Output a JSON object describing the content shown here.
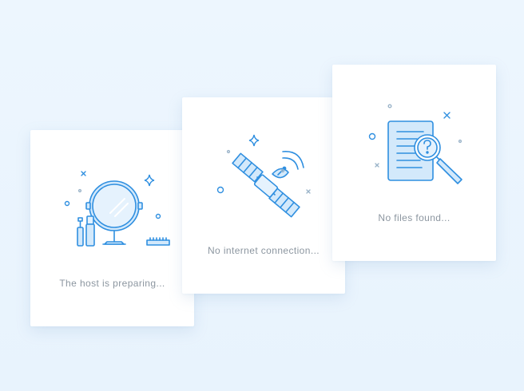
{
  "cards": [
    {
      "message": "The host is preparing...",
      "icon": "vanity-mirror-icon"
    },
    {
      "message": "No internet connection...",
      "icon": "satellite-icon"
    },
    {
      "message": "No files found...",
      "icon": "document-search-icon"
    }
  ],
  "colors": {
    "background": "#eaf4fd",
    "card": "#ffffff",
    "accent": "#2f8fe0",
    "fill": "#d3e9fb",
    "text": "#8c96a0"
  }
}
